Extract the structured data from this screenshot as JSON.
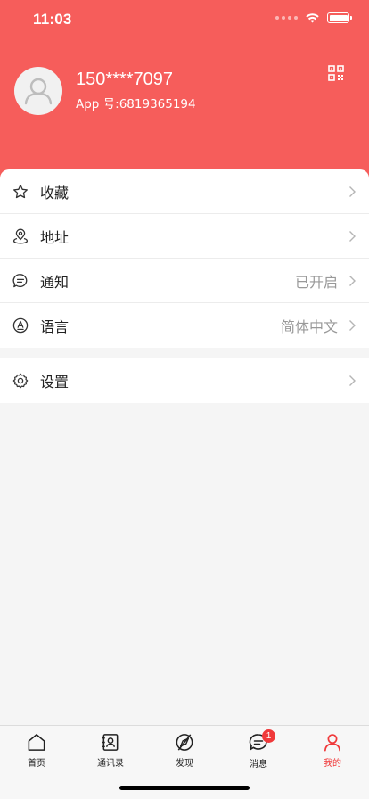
{
  "status_bar": {
    "time": "11:03"
  },
  "profile": {
    "phone": "150****7097",
    "app_id": "App 号:6819365194",
    "qr_icon": "qr-code-icon",
    "avatar_icon": "default-avatar-icon"
  },
  "menu": {
    "items": [
      {
        "label": "收藏",
        "value": "",
        "icon": "star-icon"
      },
      {
        "label": "地址",
        "value": "",
        "icon": "location-icon"
      },
      {
        "label": "通知",
        "value": "已开启",
        "icon": "chat-bubble-icon"
      },
      {
        "label": "语言",
        "value": "简体中文",
        "icon": "language-icon"
      }
    ],
    "settings": {
      "label": "设置",
      "icon": "gear-icon"
    }
  },
  "tab_bar": {
    "tabs": [
      {
        "label": "首页",
        "icon": "home-icon"
      },
      {
        "label": "通讯录",
        "icon": "contacts-icon"
      },
      {
        "label": "发现",
        "icon": "discover-icon"
      },
      {
        "label": "消息",
        "icon": "message-icon",
        "badge": "1"
      },
      {
        "label": "我的",
        "icon": "user-icon",
        "active": true
      }
    ]
  },
  "colors": {
    "primary": "#f65d5b",
    "accent": "#f0393a",
    "background": "#f5f5f5"
  }
}
